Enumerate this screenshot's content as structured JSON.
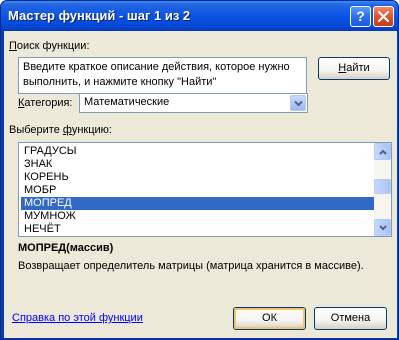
{
  "window": {
    "title": "Мастер функций - шаг 1 из 2",
    "help_button": "?",
    "close_button": "close"
  },
  "search": {
    "label_prefix": "",
    "label_mnemonic": "П",
    "label_rest": "оиск функции:",
    "line1": "Введите краткое описание действия, которое нужно",
    "line2": "выполнить, и нажмите кнопку \"Найти\"",
    "find_mnemonic": "Н",
    "find_rest": "айти"
  },
  "category": {
    "label_mnemonic": "К",
    "label_rest": "атегория:",
    "selected": "Математические"
  },
  "functions": {
    "label_prefix": "Выберите ",
    "label_mnemonic": "ф",
    "label_rest": "ункцию:",
    "items": [
      "ГРАДУСЫ",
      "ЗНАК",
      "КОРЕНЬ",
      "МОБР",
      "МОПРЕД",
      "МУМНОЖ",
      "НЕЧЁТ"
    ],
    "selected_index": 4
  },
  "details": {
    "signature": "МОПРЕД(массив)",
    "description": "Возвращает определитель матрицы (матрица хранится в массиве)."
  },
  "footer": {
    "help_link": "Справка по этой функции",
    "ok": "ОК",
    "cancel": "Отмена"
  },
  "colors": {
    "titlebar": "#0a55e4",
    "dialog_bg": "#ece9d8",
    "selection": "#316ac5",
    "link": "#0000ff"
  }
}
